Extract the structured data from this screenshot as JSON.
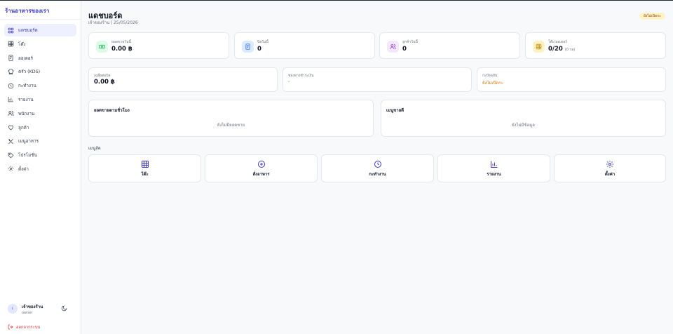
{
  "sidebar": {
    "brand": "ร้านอาหารของเรา",
    "items": [
      {
        "label": "แดชบอร์ด",
        "icon": "grid-icon"
      },
      {
        "label": "โต๊ะ",
        "icon": "table-icon"
      },
      {
        "label": "ออเดอร์",
        "icon": "receipt-icon"
      },
      {
        "label": "ครัว (KDS)",
        "icon": "chef-hat-icon"
      },
      {
        "label": "กะทำงาน",
        "icon": "clock-icon"
      },
      {
        "label": "รายงาน",
        "icon": "bar-chart-icon"
      },
      {
        "label": "พนักงาน",
        "icon": "users-icon"
      },
      {
        "label": "ลูกค้า",
        "icon": "heart-icon"
      },
      {
        "label": "เมนูอาหาร",
        "icon": "utensils-icon"
      },
      {
        "label": "โปรโมชั่น",
        "icon": "tag-icon"
      },
      {
        "label": "ตั้งค่า",
        "icon": "gear-icon"
      }
    ],
    "user": {
      "initial": "เ",
      "name": "เจ้าของร้าน",
      "role": "owner"
    },
    "logout": "ออกจากระบบ"
  },
  "header": {
    "title": "แดชบอร์ด",
    "subtitle": "เจ้าของร้าน | 25/05/2026",
    "status": "ยังไม่เปิดกะ"
  },
  "stats": [
    {
      "label": "ยอดขายวันนี้",
      "value": "0.00 ฿",
      "icon": "cash-icon",
      "color": "#16a34a",
      "bg": "#dcfce7"
    },
    {
      "label": "บิลวันนี้",
      "value": "0",
      "icon": "receipt-icon",
      "color": "#2563eb",
      "bg": "#dbeafe"
    },
    {
      "label": "ลูกค้าวันนี้",
      "value": "0",
      "icon": "users-icon",
      "color": "#9333ea",
      "bg": "#f3e8ff"
    },
    {
      "label": "โต๊ะ/ออเดอร์",
      "value": "0/20",
      "value_suffix": "(0 รอ)",
      "icon": "table-icon",
      "color": "#ca8a04",
      "bg": "#fef3c7"
    }
  ],
  "info": [
    {
      "label": "เฉลี่ยต่อบิล",
      "value": "0.00 ฿"
    },
    {
      "label": "ช่องทางชำระเงิน",
      "value": "-"
    },
    {
      "label": "กะปัจจุบัน",
      "value": "ยังไม่เปิดกะ"
    }
  ],
  "panels": [
    {
      "title": "ยอดขายตามชั่วโมง",
      "empty": "ยังไม่มียอดขาย"
    },
    {
      "title": "เมนูขายดี",
      "empty": "ยังไม่มีข้อมูล"
    }
  ],
  "quick_label": "เมนูลัด",
  "quick": [
    {
      "label": "โต๊ะ",
      "icon": "table-icon"
    },
    {
      "label": "สั่งอาหาร",
      "icon": "plus-circle-icon"
    },
    {
      "label": "กะทำงาน",
      "icon": "clock-icon"
    },
    {
      "label": "รายงาน",
      "icon": "bar-chart-icon"
    },
    {
      "label": "ตั้งค่า",
      "icon": "gear-icon"
    }
  ],
  "colors": {
    "accent": "#3b37c9",
    "warn": "#d97706",
    "danger": "#dc2626"
  }
}
